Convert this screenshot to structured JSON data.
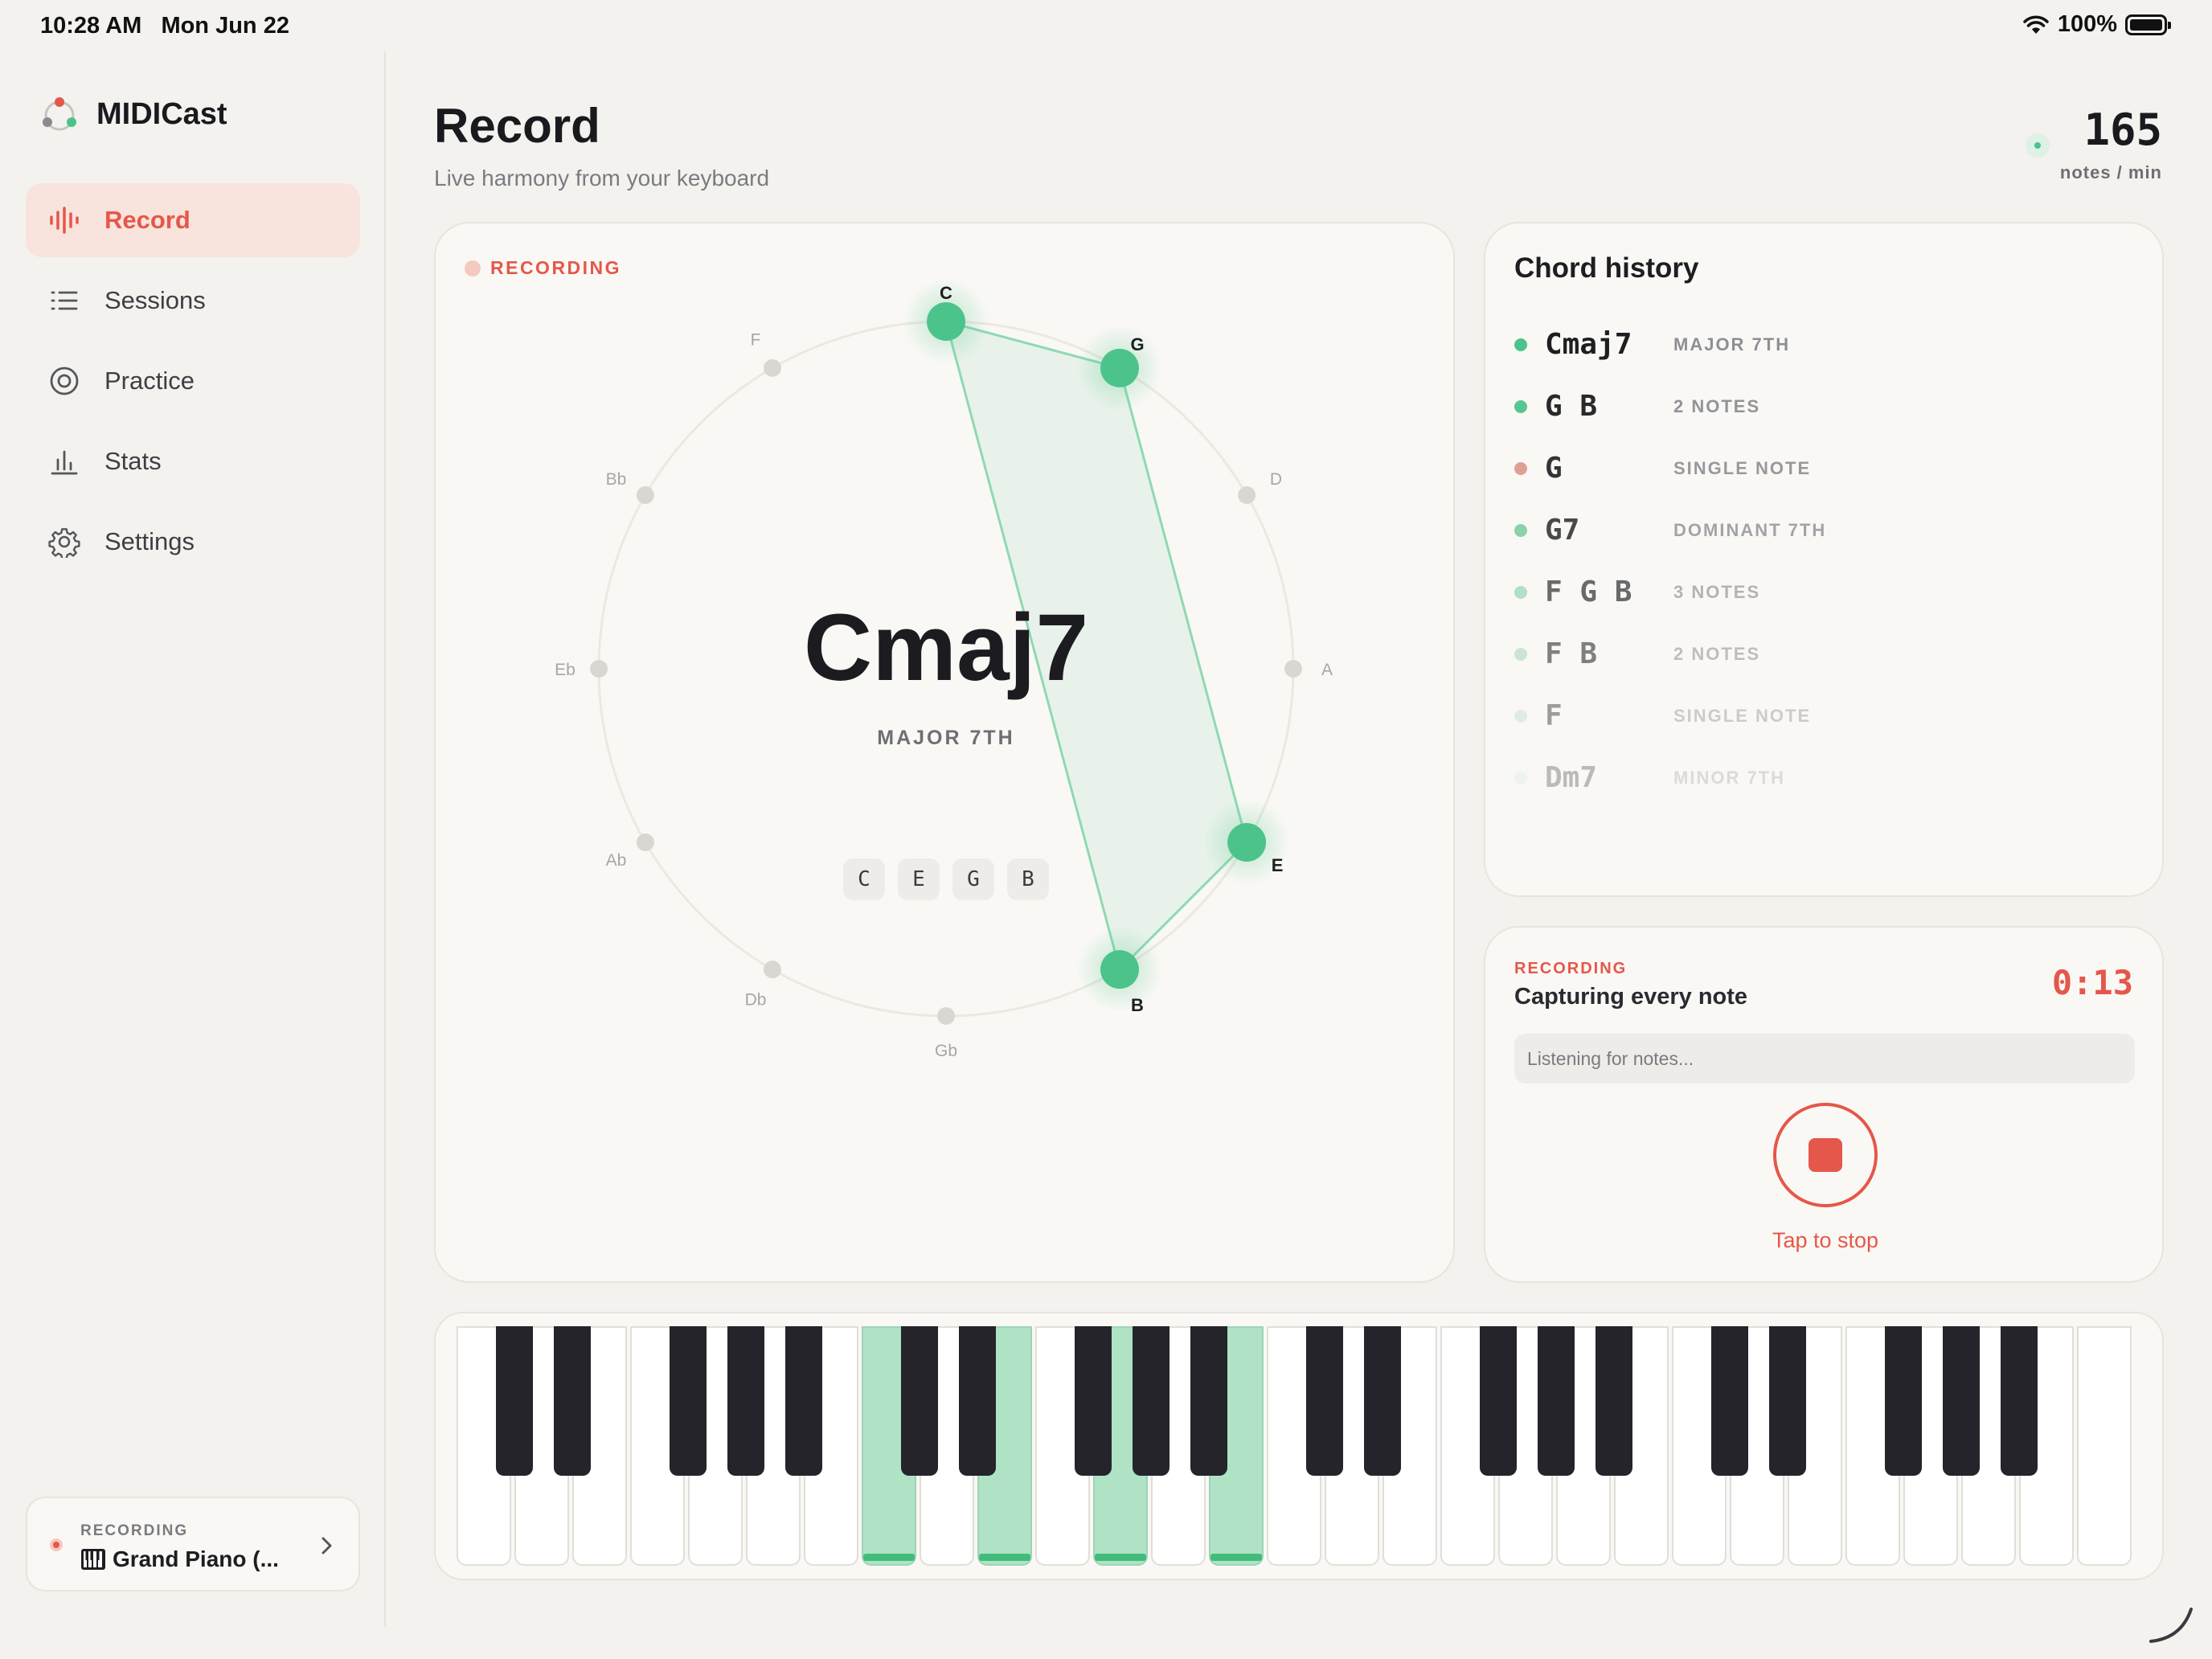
{
  "status_bar": {
    "time": "10:28 AM",
    "date": "Mon Jun 22",
    "battery": "100%"
  },
  "app": {
    "name": "MIDICast"
  },
  "sidebar": {
    "items": [
      {
        "label": "Record",
        "icon": "waveform-icon",
        "active": true
      },
      {
        "label": "Sessions",
        "icon": "list-icon",
        "active": false
      },
      {
        "label": "Practice",
        "icon": "target-icon",
        "active": false
      },
      {
        "label": "Stats",
        "icon": "bar-chart-icon",
        "active": false
      },
      {
        "label": "Settings",
        "icon": "gear-icon",
        "active": false
      }
    ],
    "device": {
      "status": "RECORDING",
      "name": "Grand Piano (..."
    }
  },
  "header": {
    "title": "Record",
    "subtitle": "Live harmony from your keyboard",
    "rate_value": "165",
    "rate_unit": "notes / min"
  },
  "wheel": {
    "recording_label": "RECORDING",
    "chord": "Cmaj7",
    "quality": "MAJOR 7TH",
    "notes": [
      "C",
      "E",
      "G",
      "B"
    ],
    "circle_labels": [
      "C",
      "G",
      "D",
      "A",
      "E",
      "B",
      "Gb",
      "Db",
      "Ab",
      "Eb",
      "Bb",
      "F"
    ],
    "active_labels": [
      "C",
      "G",
      "E",
      "B"
    ]
  },
  "history": {
    "title": "Chord history",
    "rows": [
      {
        "name": "Cmaj7",
        "desc": "MAJOR 7TH",
        "dot": "#4CC38A",
        "opacity": 1.0
      },
      {
        "name": "G B",
        "desc": "2 NOTES",
        "dot": "#4CC38A",
        "opacity": 0.95
      },
      {
        "name": "G",
        "desc": "SINGLE NOTE",
        "dot": "#D9978A",
        "opacity": 0.9
      },
      {
        "name": "G7",
        "desc": "DOMINANT 7TH",
        "dot": "#6CC99A",
        "opacity": 0.8
      },
      {
        "name": "F G B",
        "desc": "3 NOTES",
        "dot": "#8FCFAE",
        "opacity": 0.65
      },
      {
        "name": "F B",
        "desc": "2 NOTES",
        "dot": "#A5D3BB",
        "opacity": 0.55
      },
      {
        "name": "F",
        "desc": "SINGLE NOTE",
        "dot": "#BDD9CA",
        "opacity": 0.42
      },
      {
        "name": "Dm7",
        "desc": "MINOR 7TH",
        "dot": "#D4E6DC",
        "opacity": 0.28
      }
    ]
  },
  "recorder": {
    "label": "RECORDING",
    "status": "Capturing every note",
    "timer": "0:13",
    "input_placeholder": "Listening for notes...",
    "stop_label": "Tap to stop"
  },
  "piano": {
    "white_key_count": 29,
    "pressed_white_keys": [
      7,
      9,
      11,
      13
    ]
  },
  "colors": {
    "accent": "#E5574A",
    "active_note": "#4CC38A",
    "background": "#F4F2EE",
    "card": "#FAF8F5"
  }
}
